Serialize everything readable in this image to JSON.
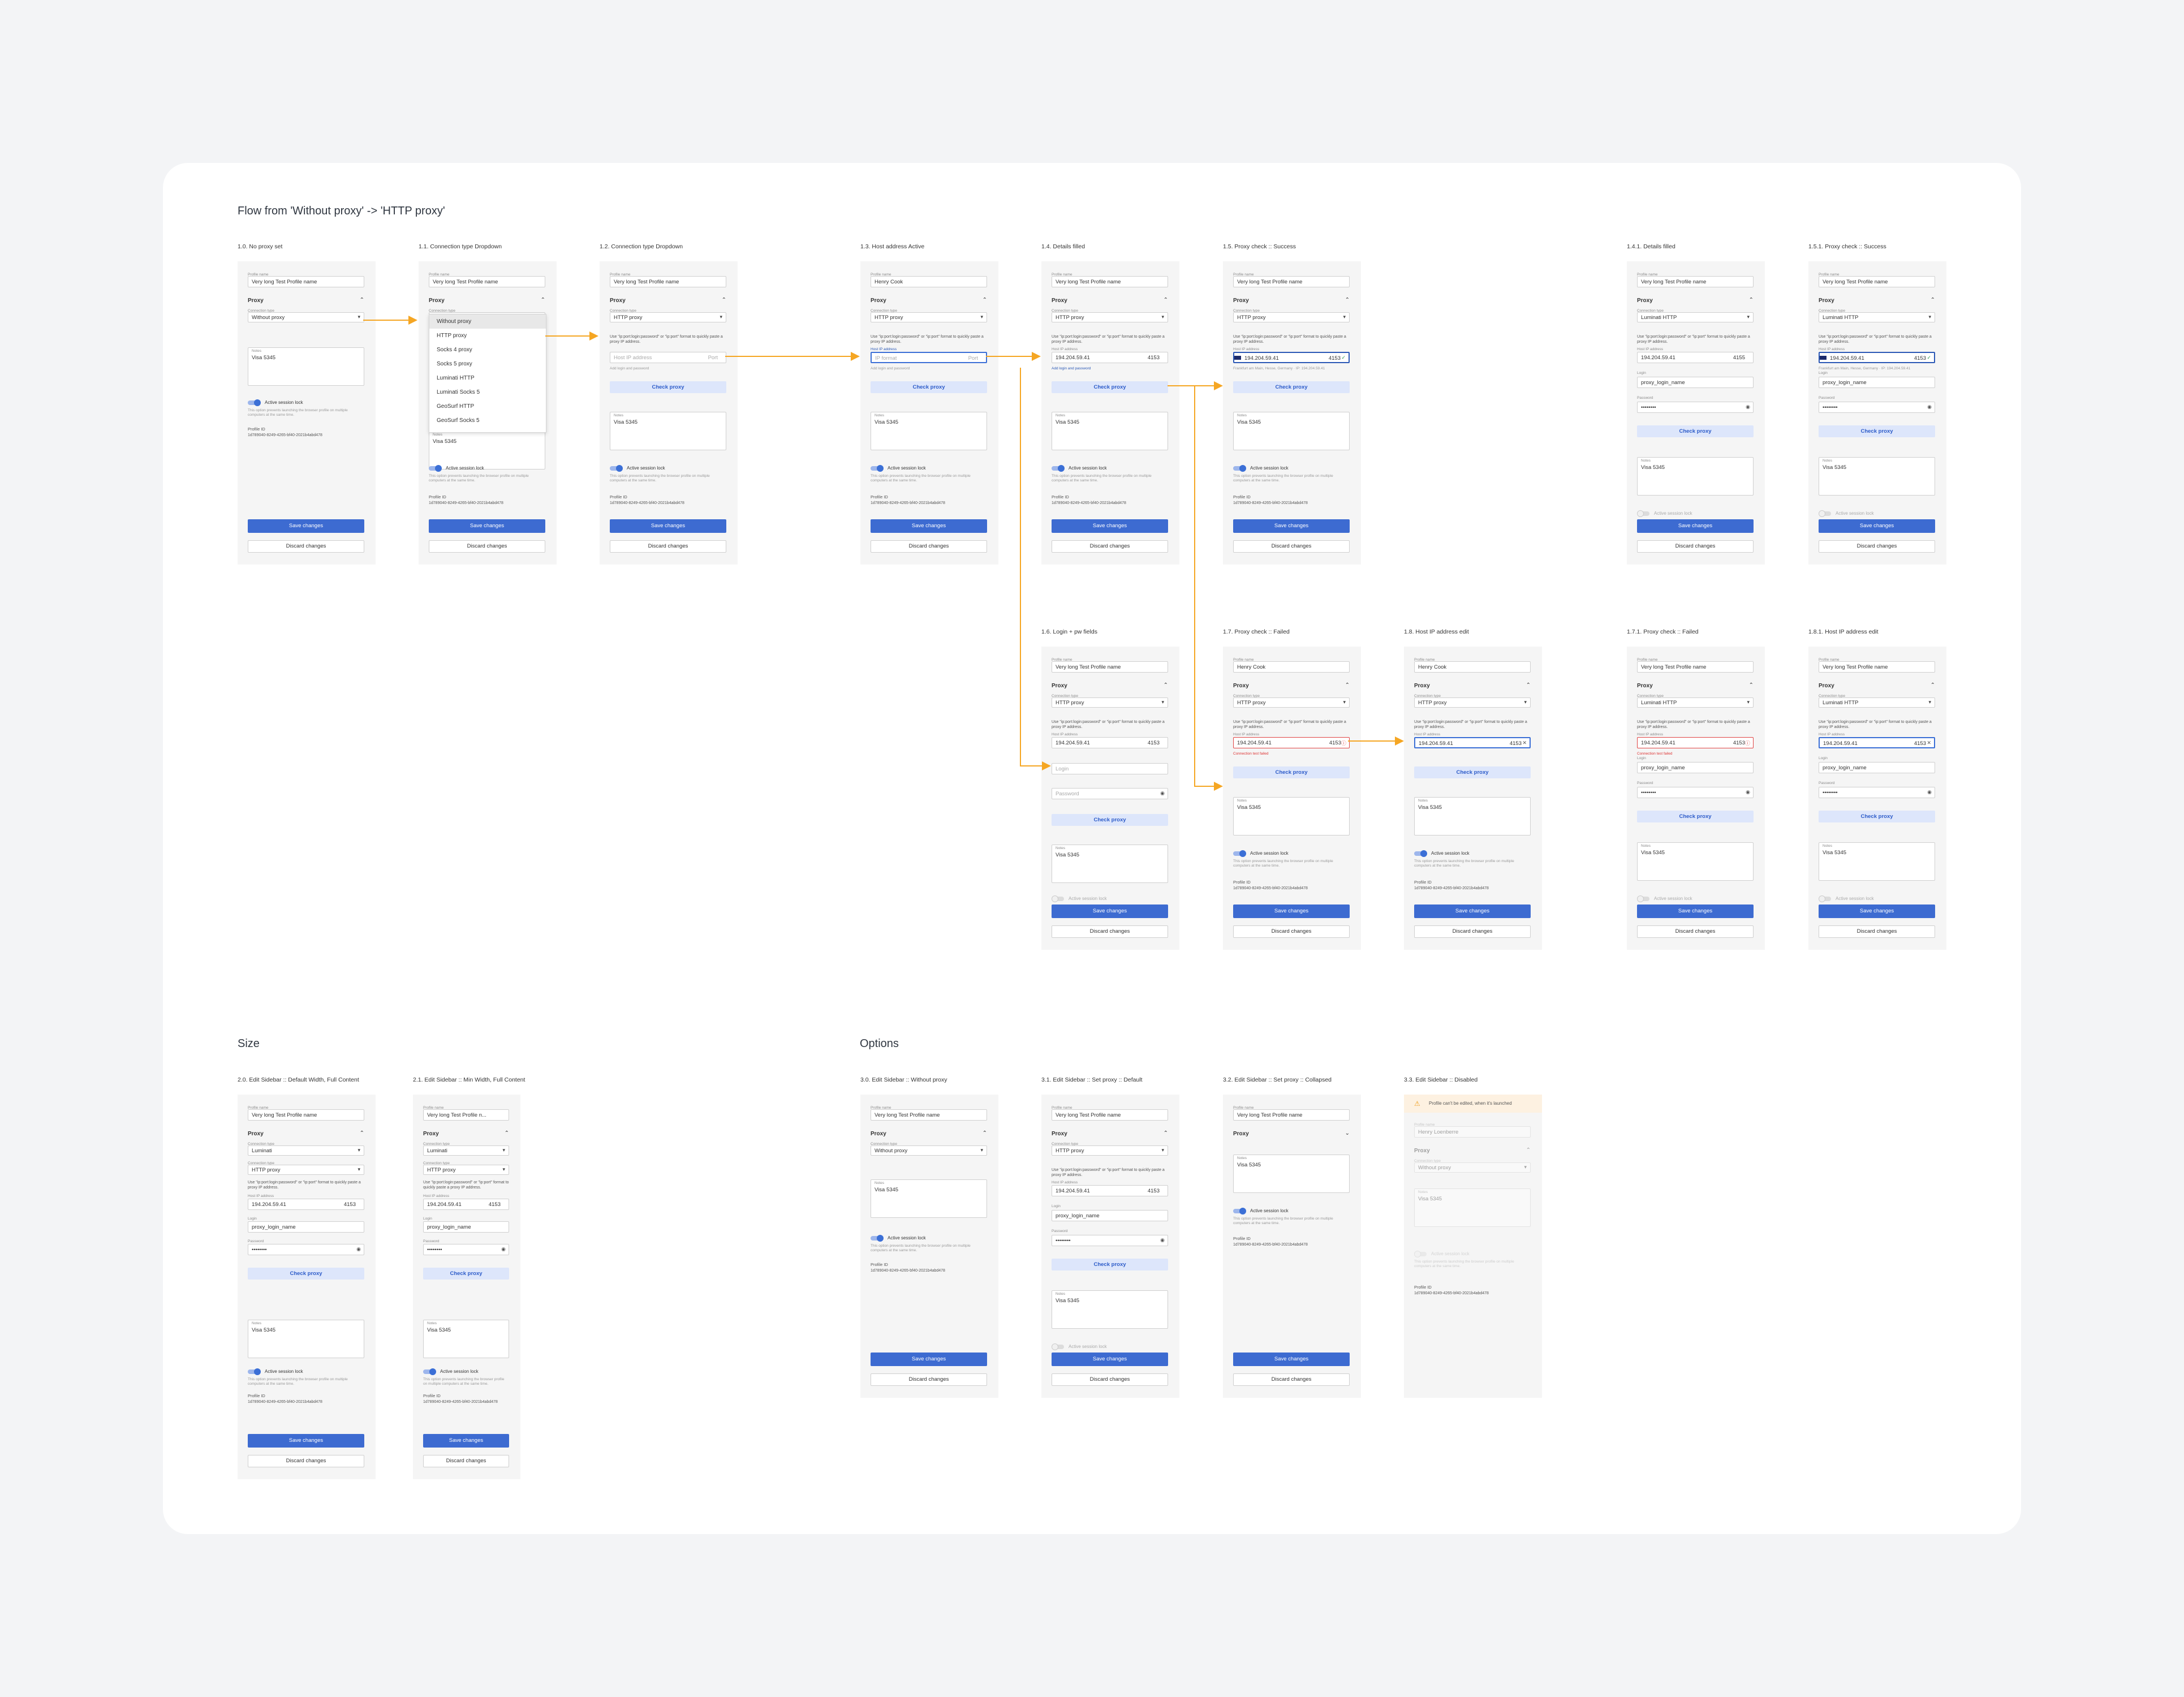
{
  "sections": {
    "flow": "Flow from 'Without proxy' -> 'HTTP proxy'",
    "size": "Size",
    "options": "Options"
  },
  "ui": {
    "profile_name": "Profile name",
    "proxy": "Proxy",
    "connection_type": "Connection type",
    "host_ip": "Host IP address",
    "port": "Port",
    "login": "Login",
    "password": "Password",
    "notes": "Notes",
    "hint": "Use \"ip:port:login:password\" or \"ip:port\" format to quickly paste a proxy IP address.",
    "add_login": "Add login and password",
    "check_proxy": "Check proxy",
    "active_session_lock": "Active session lock",
    "lock_desc": "This option prevents launching the browser profile on multiple computers at the same time.",
    "profile_id_label": "Profile ID",
    "profile_id": "1d789040-8249-4265-bf40-2021b4abd478",
    "save": "Save changes",
    "discard": "Discard changes",
    "pw_mask": "••••••••",
    "conn_failed": "Connection test failed",
    "success_text": "Frankfurt am Main, Hesse, Germany · IP: 194.204.59.41",
    "launched_warning": "Profile can't be edited, when it's launched"
  },
  "dropdown_options": [
    "Without proxy",
    "HTTP proxy",
    "Socks 4 proxy",
    "Socks 5 proxy",
    "Luminati HTTP",
    "Luminati Socks 5",
    "GeoSurf HTTP",
    "GeoSurf Socks 5"
  ],
  "icons": {
    "chevron_up": "chevron-up-icon",
    "chevron_down": "chevron-down-icon",
    "eye": "eye-icon",
    "check": "check-icon",
    "error": "error-icon",
    "clear": "close-icon",
    "warning": "warning-icon"
  },
  "colors": {
    "accent": "#3d6bd1",
    "arrow": "#f5a623",
    "error": "#e04545"
  },
  "frames": [
    {
      "title": "1.0. No proxy set",
      "name": "Very long Test Profile name",
      "conn": "Without proxy",
      "notes": "Visa 5345"
    },
    {
      "title": "1.1. Connection type Dropdown",
      "name": "Very long Test Profile name",
      "conn": "Without proxy",
      "notes": "Visa 5345"
    },
    {
      "title": "1.2. Connection type Dropdown",
      "name": "Very long Test Profile name",
      "conn": "HTTP proxy",
      "host": "Host IP address",
      "notes": "Visa 5345"
    },
    {
      "title": "1.3. Host address Active",
      "name": "Henry Cook",
      "conn": "HTTP proxy",
      "host": "IP format",
      "notes": "Visa 5345"
    },
    {
      "title": "1.4. Details filled",
      "name": "Very long Test Profile name",
      "conn": "HTTP proxy",
      "host": "194.204.59.41",
      "port": "4153",
      "notes": "Visa 5345"
    },
    {
      "title": "1.5. Proxy check :: Success",
      "name": "Very long Test Profile name",
      "conn": "HTTP proxy",
      "host": "194.204.59.41",
      "port": "4153",
      "notes": "Visa 5345"
    },
    {
      "title": "1.4.1. Details filled",
      "name": "Very long Test Profile name",
      "conn": "Luminati HTTP",
      "host": "194.204.59.41",
      "port": "4155",
      "login": "proxy_login_name",
      "notes": "Visa 5345"
    },
    {
      "title": "1.5.1. Proxy check :: Success",
      "name": "Very long Test Profile name",
      "conn": "Luminati HTTP",
      "host": "194.204.59.41",
      "port": "4153",
      "login": "proxy_login_name",
      "notes": "Visa 5345"
    },
    {
      "title": "1.6. Login + pw fields",
      "name": "Very long Test Profile name",
      "conn": "HTTP proxy",
      "host": "194.204.59.41",
      "port": "4153",
      "notes": "Visa 5345"
    },
    {
      "title": "1.7. Proxy check :: Failed",
      "name": "Henry Cook",
      "conn": "HTTP proxy",
      "host": "194.204.59.41",
      "port": "4153",
      "notes": "Visa 5345"
    },
    {
      "title": "1.8. Host IP address edit",
      "name": "Henry Cook",
      "conn": "HTTP proxy",
      "host": "194.204.59.41",
      "port": "4153",
      "notes": "Visa 5345"
    },
    {
      "title": "1.7.1. Proxy check :: Failed",
      "name": "Very long Test Profile name",
      "conn": "Luminati HTTP",
      "host": "194.204.59.41",
      "port": "4153",
      "login": "proxy_login_name",
      "notes": "Visa 5345"
    },
    {
      "title": "1.8.1. Host IP address edit",
      "name": "Very long Test Profile name",
      "conn": "Luminati HTTP",
      "host": "194.204.59.41",
      "port": "4153",
      "login": "proxy_login_name",
      "notes": "Visa 5345"
    },
    {
      "title": "2.0. Edit Sidebar :: Default Width, Full Content",
      "name": "Very long Test Profile name",
      "provider": "Luminati",
      "conn": "HTTP proxy",
      "host": "194.204.59.41",
      "port": "4153",
      "login": "proxy_login_name",
      "notes": "Visa 5345"
    },
    {
      "title": "2.1. Edit Sidebar :: Min Width, Full Content",
      "name": "Very long Test Profile n...",
      "provider": "Luminati",
      "conn": "HTTP proxy",
      "host": "194.204.59.41",
      "port": "4153",
      "login": "proxy_login_name",
      "notes": "Visa 5345"
    },
    {
      "title": "3.0. Edit Sidebar :: Without proxy",
      "name": "Very long Test Profile name",
      "conn": "Without proxy",
      "notes": "Visa 5345"
    },
    {
      "title": "3.1. Edit Sidebar :: Set proxy :: Default",
      "name": "Very long Test Profile name",
      "conn": "HTTP proxy",
      "host": "194.204.59.41",
      "port": "4153",
      "login": "proxy_login_name",
      "notes": "Visa 5345"
    },
    {
      "title": "3.2. Edit Sidebar :: Set proxy :: Collapsed",
      "name": "Very long Test Profile name",
      "notes": "Visa 5345"
    },
    {
      "title": "3.3. Edit Sidebar :: Disabled",
      "name": "Henry Loenberre",
      "conn": "Without proxy",
      "notes": "Visa 5345"
    }
  ]
}
